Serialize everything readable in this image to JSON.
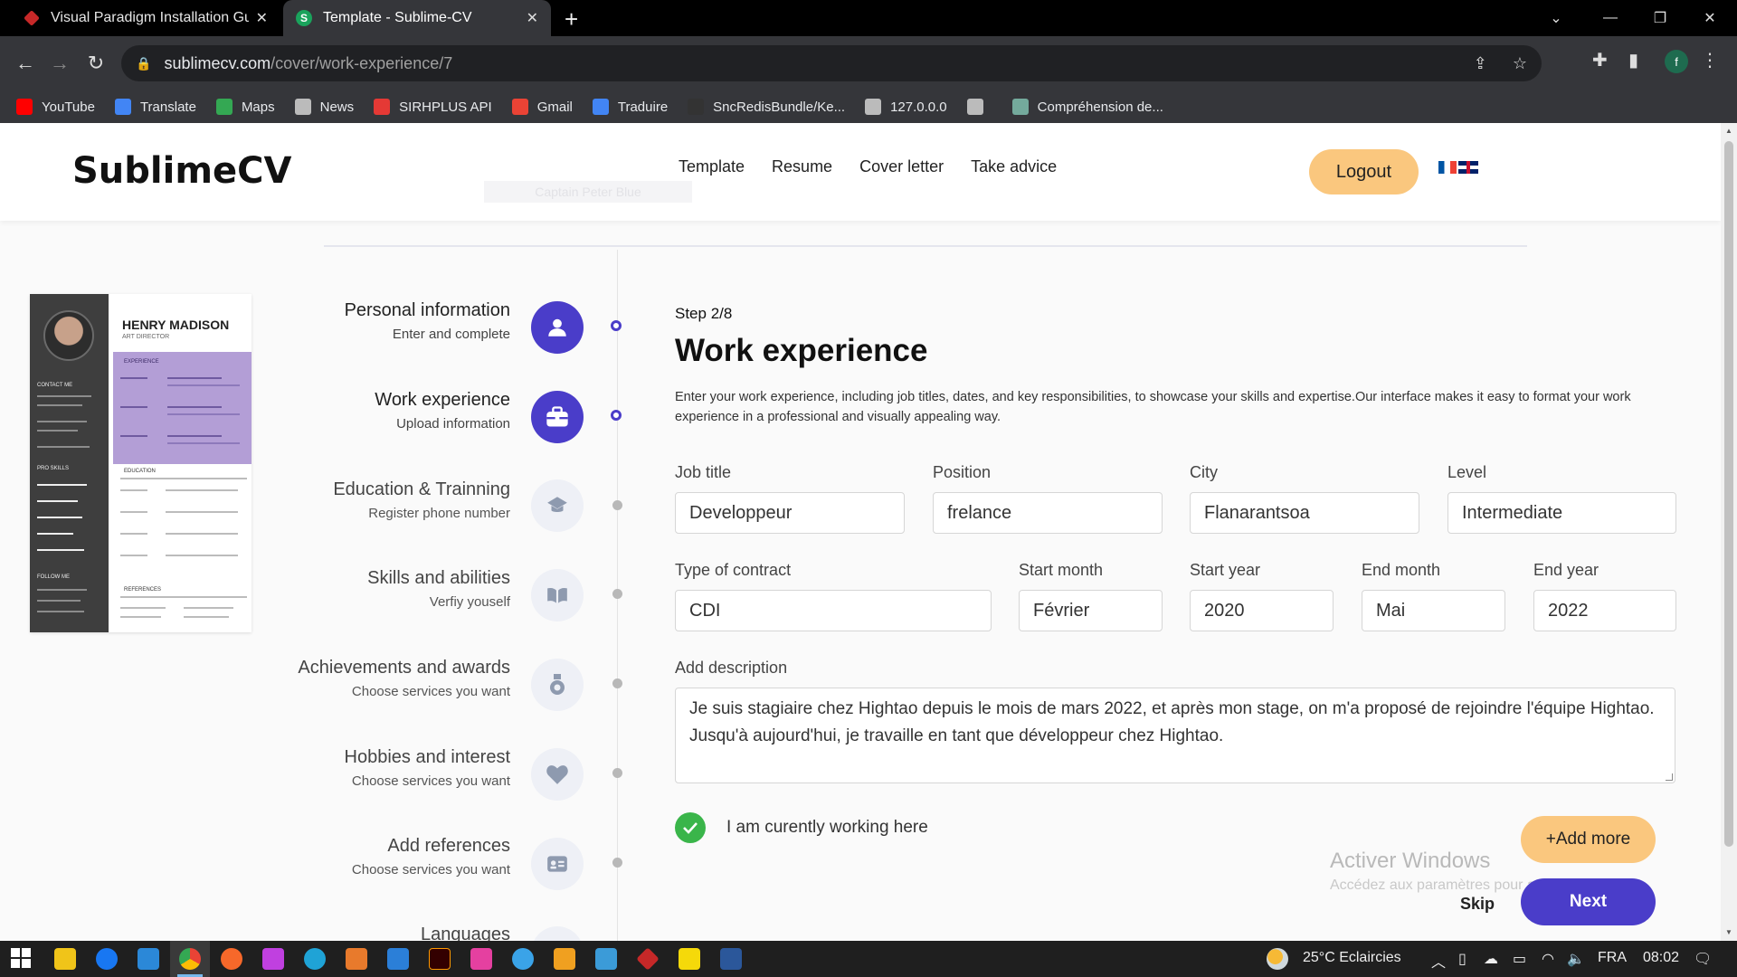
{
  "browser": {
    "tabs": [
      {
        "title": "Visual Paradigm Installation Gui",
        "active": false
      },
      {
        "title": "Template - Sublime-CV",
        "active": true
      }
    ],
    "url_host": "sublimecv.com",
    "url_path": "/cover/work-experience/7",
    "profile_initial": "f",
    "bookmarks": [
      {
        "label": "YouTube",
        "color": "#ff0000"
      },
      {
        "label": "Translate",
        "color": "#4285f4"
      },
      {
        "label": "Maps",
        "color": "#34a853"
      },
      {
        "label": "News",
        "color": "#bbbbbb"
      },
      {
        "label": "SIRHPLUS API",
        "color": "#e53935"
      },
      {
        "label": "Gmail",
        "color": "#ea4335"
      },
      {
        "label": "Traduire",
        "color": "#4285f4"
      },
      {
        "label": "SncRedisBundle/Ke...",
        "color": "#333333"
      },
      {
        "label": "127.0.0.0",
        "color": "#bbbbbb"
      },
      {
        "label": "",
        "color": "#bbbbbb"
      },
      {
        "label": "Compréhension de...",
        "color": "#74aa9c"
      }
    ]
  },
  "site": {
    "logo": "SublimeCV",
    "nav": [
      "Template",
      "Resume",
      "Cover letter",
      "Take advice"
    ],
    "logout": "Logout",
    "ghost_text": "Captain Peter Blue"
  },
  "cv_preview": {
    "name": "HENRY MADISON",
    "role": "ART DIRECTOR",
    "sections": [
      "EXPERIENCE",
      "EDUCATION",
      "REFERENCES"
    ],
    "side_sections": [
      "CONTACT ME",
      "PRO SKILLS",
      "FOLLOW ME"
    ]
  },
  "steps": [
    {
      "title": "Personal information",
      "desc": "Enter and complete",
      "icon": "user-icon",
      "active": true
    },
    {
      "title": "Work experience",
      "desc": "Upload information",
      "icon": "briefcase-icon",
      "active": true
    },
    {
      "title": "Education & Trainning",
      "desc": "Register phone number",
      "icon": "graduation-cap-icon",
      "active": false
    },
    {
      "title": "Skills and abilities",
      "desc": "Verfiy youself",
      "icon": "book-icon",
      "active": false
    },
    {
      "title": "Achievements and awards",
      "desc": "Choose services you want",
      "icon": "medal-icon",
      "active": false
    },
    {
      "title": "Hobbies and interest",
      "desc": "Choose services you want",
      "icon": "heart-icon",
      "active": false
    },
    {
      "title": "Add references",
      "desc": "Choose services you want",
      "icon": "id-card-icon",
      "active": false
    },
    {
      "title": "Languages",
      "desc": "",
      "icon": "language-icon",
      "active": false
    }
  ],
  "form": {
    "step_label": "Step 2/8",
    "title": "Work experience",
    "description": "Enter your work experience, including job titles, dates, and key responsibilities, to showcase your skills and expertise.Our interface makes it easy to format your work experience in a professional and visually appealing way.",
    "fields": {
      "job_title": {
        "label": "Job title",
        "value": "Developpeur"
      },
      "position": {
        "label": "Position",
        "value": "frelance"
      },
      "city": {
        "label": "City",
        "value": "Flanarantsoa"
      },
      "level": {
        "label": "Level",
        "value": "Intermediate"
      },
      "contract": {
        "label": "Type of contract",
        "value": "CDI"
      },
      "start_month": {
        "label": "Start month",
        "value": "Février"
      },
      "start_year": {
        "label": "Start year",
        "value": "2020"
      },
      "end_month": {
        "label": "End month",
        "value": "Mai"
      },
      "end_year": {
        "label": "End year",
        "value": "2022"
      },
      "description": {
        "label": "Add description",
        "value": "Je suis stagiaire chez Hightao depuis le mois de mars 2022, et après mon stage, on m'a proposé de rejoindre l'équipe Hightao. Jusqu'à aujourd'hui, je travaille en tant que développeur chez Hightao."
      }
    },
    "currently_working_label": "I am curently working here",
    "currently_working": true,
    "add_more": "+Add more",
    "skip": "Skip",
    "next": "Next"
  },
  "watermark": {
    "title": "Activer Windows",
    "subtitle": "Accédez aux paramètres pour activer Windows."
  },
  "taskbar": {
    "weather": "25°C  Eclaircies",
    "lang": "FRA",
    "time": "08:02"
  },
  "colors": {
    "accent_purple": "#4a3dc9",
    "accent_orange": "#fac77e",
    "check_green": "#3ab54a"
  }
}
